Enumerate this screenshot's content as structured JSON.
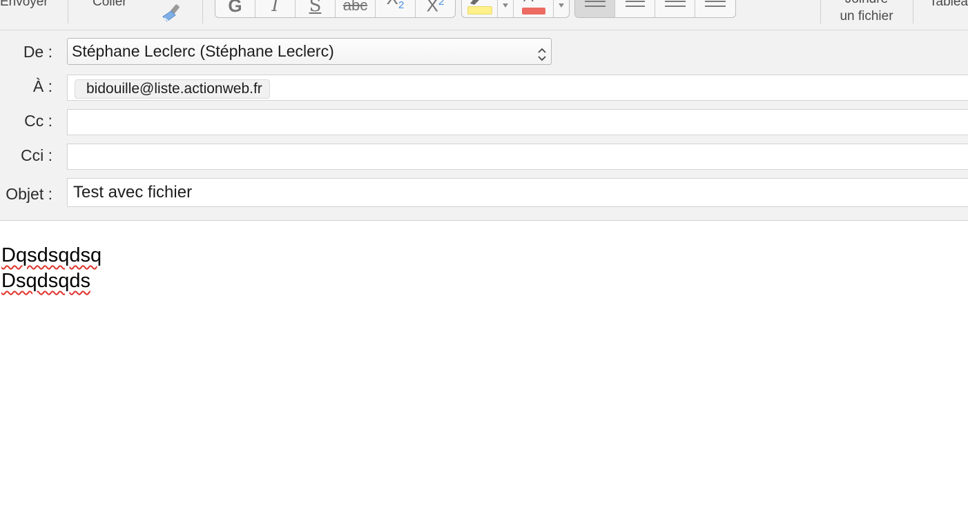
{
  "toolbar": {
    "send_label": "Envoyer",
    "paste_label": "Coller",
    "attach_label_line1": "Joindre",
    "attach_label_line2": "un fichier",
    "table_label": "Tablea",
    "format_buttons": [
      {
        "name": "bold-button",
        "glyph": "G"
      },
      {
        "name": "italic-button",
        "glyph": "I"
      },
      {
        "name": "underline-button",
        "glyph": "S"
      },
      {
        "name": "strikethrough-button",
        "glyph": "abc"
      },
      {
        "name": "subscript-button",
        "glyph": "X",
        "small": "2"
      },
      {
        "name": "superscript-button",
        "glyph": "X",
        "small": "2"
      }
    ],
    "highlight_color": "#fff08a",
    "text_color": "#ec6b62",
    "align_buttons": [
      "align-left-button",
      "align-center-button",
      "align-right-button",
      "align-justify-button"
    ],
    "active_alignment": "align-left-button"
  },
  "header": {
    "from_label": "De :",
    "from_value": "Stéphane Leclerc (Stéphane Leclerc)",
    "to_label": "À :",
    "to_recipients": [
      "bidouille@liste.actionweb.fr"
    ],
    "cc_label": "Cc :",
    "cc_value": "",
    "bcc_label": "Cci :",
    "bcc_value": "",
    "subject_label": "Objet :",
    "subject_value": "Test avec fichier"
  },
  "body": {
    "lines": [
      "Dqsdsqdsq",
      "Dsqdsqds"
    ]
  },
  "colors": {
    "chrome_background": "#f2f2f2",
    "spellcheck_underline": "#e0332c",
    "highlight_swatch": "#fff08a",
    "text_color_swatch": "#ec6b62"
  }
}
